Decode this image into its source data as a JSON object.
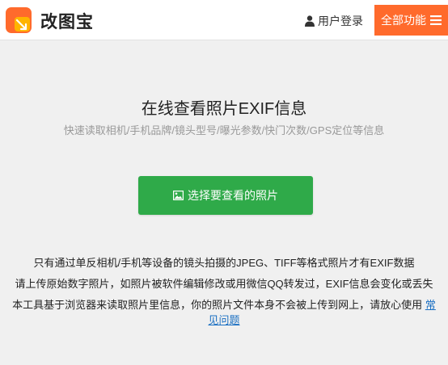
{
  "header": {
    "logo_text": "改图宝",
    "login_label": "用户登录",
    "menu_label": "全部功能",
    "colors": {
      "logo_orange": "#ff6a2c",
      "logo_yellow": "#ffb400",
      "menu_bg": "#ff6a2c"
    }
  },
  "main": {
    "title": "在线查看照片EXIF信息",
    "subtitle": "快速读取相机/手机品牌/镜头型号/曝光参数/快门次数/GPS定位等信息",
    "select_button_label": "选择要查看的照片",
    "select_button_color": "#2faa49"
  },
  "notes": {
    "line1": "只有通过单反相机/手机等设备的镜头拍摄的JPEG、TIFF等格式照片才有EXIF数据",
    "line2": "请上传原始数字照片，如照片被软件编辑修改或用微信QQ转发过，EXIF信息会变化或丢失",
    "line3": "本工具基于浏览器来读取照片里信息，你的照片文件本身不会被上传到网上，请放心使用",
    "faq_link": "常见问题",
    "link_color": "#1a6fc2"
  },
  "icons": {
    "logo": "app-logo-icon",
    "login": "user-icon",
    "menu": "hamburger-icon",
    "select": "image-icon"
  }
}
